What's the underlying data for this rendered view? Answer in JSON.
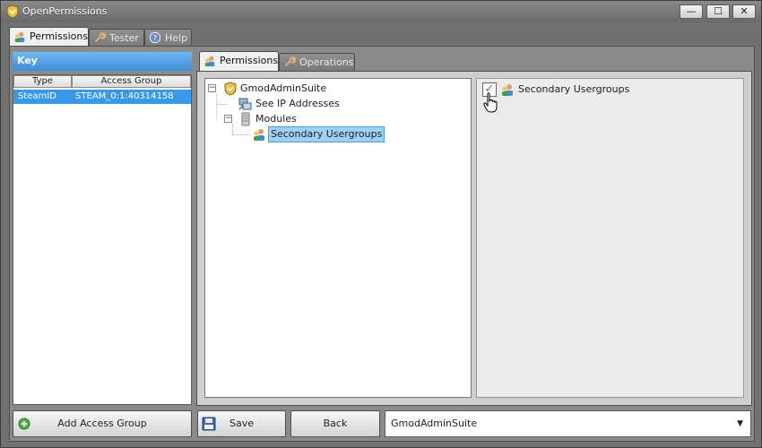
{
  "window": {
    "title": "OpenPermissions",
    "min": "—",
    "max": "☐",
    "close": "✕"
  },
  "top_tabs": [
    {
      "label": "Permissions",
      "icon": "users-icon",
      "active": true
    },
    {
      "label": "Tester",
      "icon": "wrench-icon",
      "active": false
    },
    {
      "label": "Help",
      "icon": "help-icon",
      "active": false
    }
  ],
  "key_panel": {
    "title": "Key",
    "columns": [
      "Type",
      "Access Group"
    ],
    "rows": [
      {
        "type": "SteamID",
        "group": "STEAM_0:1:40314158",
        "selected": true
      }
    ],
    "add_button": "Add Access Group"
  },
  "inner_tabs": [
    {
      "label": "Permissions",
      "icon": "users-icon",
      "active": true
    },
    {
      "label": "Operations",
      "icon": "wrench-icon",
      "active": false
    }
  ],
  "tree": {
    "root": {
      "label": "GmodAdminSuite",
      "icon": "shield-icon",
      "expander": "−"
    },
    "children": [
      {
        "label": "See IP Addresses",
        "icon": "network-icon"
      },
      {
        "label": "Modules",
        "icon": "server-icon",
        "expander": "−"
      },
      {
        "label": "Secondary Usergroups",
        "icon": "users-icon",
        "selected": true
      }
    ]
  },
  "permission_detail": {
    "label": "Secondary Usergroups",
    "checked": true,
    "check_glyph": "✓"
  },
  "buttons": {
    "save": "Save",
    "back": "Back"
  },
  "addon_select": {
    "value": "GmodAdminSuite",
    "arrow": "▼"
  },
  "colors": {
    "selection_blue": "#3998e8",
    "header_blue": "#4a9fe0"
  }
}
